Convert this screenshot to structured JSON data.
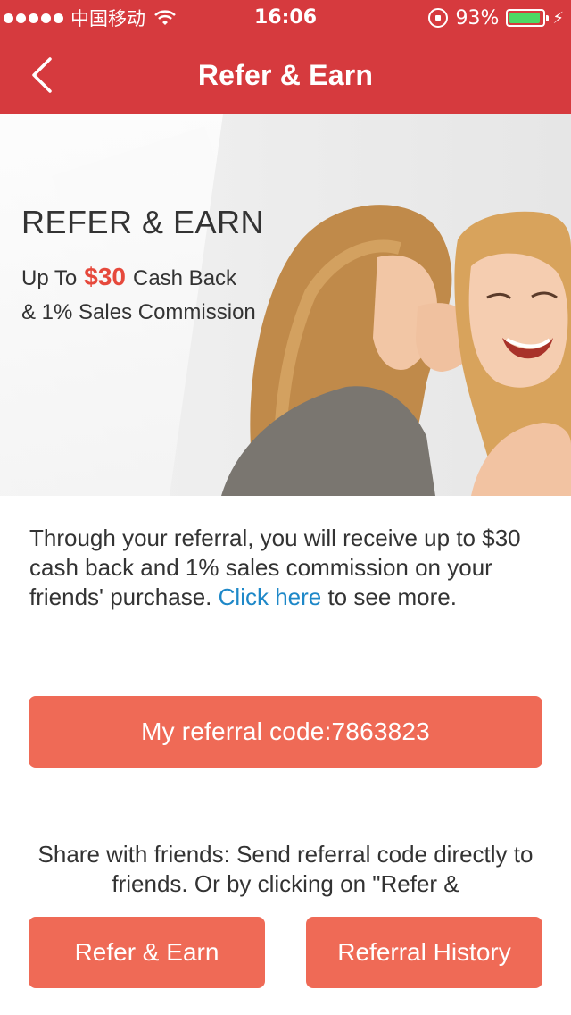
{
  "status_bar": {
    "carrier": "中国移动",
    "time": "16:06",
    "battery": "93%",
    "battery_level": 0.93,
    "battery_color": "#4cd964"
  },
  "nav": {
    "title": "Refer & Earn",
    "back_icon": "chevron-left-icon",
    "color": "#d63a3e"
  },
  "hero": {
    "title": "REFER & EARN",
    "line1_prefix": "Up To",
    "amount": "$30",
    "line1_suffix": "Cash Back",
    "line2": "& 1% Sales Commission"
  },
  "description": {
    "text_before": "Through your referral, you will receive up to $30 cash back and 1% sales commission on your friends' purchase. ",
    "link": "Click here",
    "text_after": " to see more."
  },
  "referral_button": {
    "label": "My referral code:7863823",
    "color": "#ef6a56"
  },
  "share_text": "Share with friends: Send referral code directly to friends. Or by clicking on \"Refer &",
  "actions": {
    "refer_label": "Refer & Earn",
    "history_label": "Referral History"
  },
  "link_color": "#1e88c8"
}
